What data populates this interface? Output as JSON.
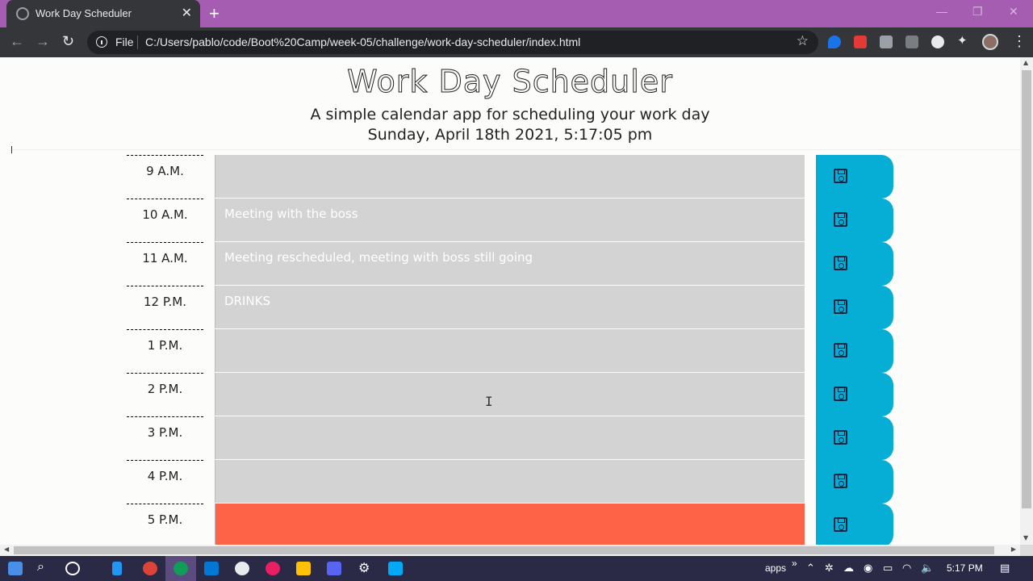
{
  "browser": {
    "tab_title": "Work Day Scheduler",
    "new_tab": "+",
    "close_tab": "✕",
    "file_label": "File",
    "url": "C:/Users/pablo/code/Boot%20Camp/week-05/challenge/work-day-scheduler/index.html",
    "window_controls": {
      "minimize": "—",
      "restore": "❐",
      "close": "✕"
    }
  },
  "header": {
    "title": "Work Day Scheduler",
    "lead": "A simple calendar app for scheduling your work day",
    "current_day": "Sunday, April 18th 2021, 5:17:05 pm"
  },
  "rows": [
    {
      "hour": "9 A.M.",
      "text": "",
      "state": "past"
    },
    {
      "hour": "10 A.M.",
      "text": "Meeting with the boss",
      "state": "past"
    },
    {
      "hour": "11 A.M.",
      "text": "Meeting rescheduled, meeting with boss still going",
      "state": "past"
    },
    {
      "hour": "12 P.M.",
      "text": "DRINKS",
      "state": "past"
    },
    {
      "hour": "1 P.M.",
      "text": "",
      "state": "past"
    },
    {
      "hour": "2 P.M.",
      "text": "",
      "state": "past"
    },
    {
      "hour": "3 P.M.",
      "text": "",
      "state": "past"
    },
    {
      "hour": "4 P.M.",
      "text": "",
      "state": "past"
    },
    {
      "hour": "5 P.M.",
      "text": "",
      "state": "present"
    }
  ],
  "colors": {
    "past": "#d3d3d3",
    "present": "#ff6347",
    "save_button": "#06aed5",
    "tab_strip": "#a55db1"
  },
  "taskbar": {
    "apps_label": "apps",
    "apps_chevron": "»",
    "clock": "5:17 PM"
  }
}
